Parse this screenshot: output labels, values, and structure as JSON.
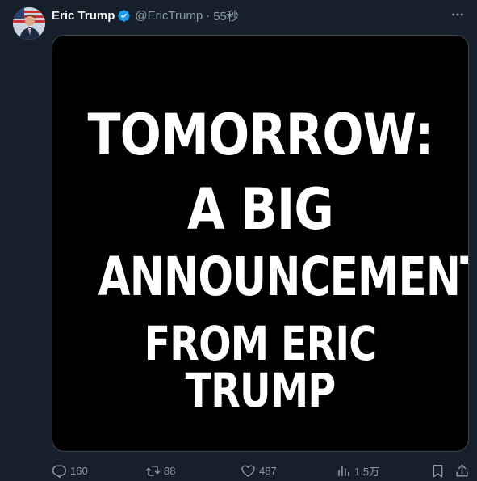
{
  "author": {
    "display_name": "Eric Trump",
    "handle": "@EricTrump",
    "separator": "·",
    "timestamp": "55秒",
    "verified_icon": "verified-badge-icon",
    "verified_color": "#1d9bf0"
  },
  "media": {
    "lines": [
      "TOMORROW:",
      "A BIG",
      "ANNOUNCEMENT",
      "FROM ERIC TRUMP"
    ]
  },
  "actions": {
    "replies": "160",
    "retweets": "88",
    "likes": "487",
    "views": "1.5万"
  },
  "colors": {
    "background": "#15202b",
    "text_primary": "#f7f9f9",
    "text_secondary": "#8b98a5",
    "media_background": "#000000",
    "media_text": "#ffffff"
  }
}
